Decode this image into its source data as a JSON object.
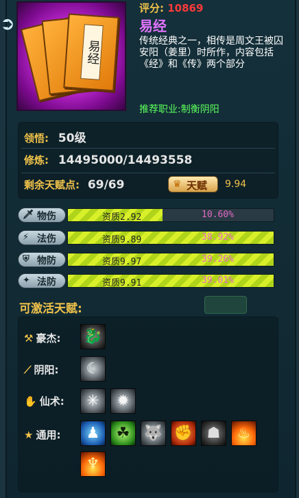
{
  "item": {
    "rating_label": "评分:",
    "rating_value": "10869",
    "name": "易经",
    "book_glyph": "易经",
    "description": "传统经典之一，相传是周文王被囚安阳（姜里）时所作，内容包括《经》和《传》两个部分",
    "recommend": "推荐职业:制衡阴阳"
  },
  "stats": {
    "comprehension_label": "领悟:",
    "comprehension_value": "50级",
    "training_label": "修炼:",
    "training_value": "14495000/14493558",
    "talent_points_label": "剩余天赋点:",
    "talent_points_value": "69/69",
    "talent_button_label": "天赋",
    "talent_bonus": "9.94"
  },
  "aptitudes": [
    {
      "label": "物伤",
      "icon": "sword-icon",
      "glyph": "🗡",
      "quality": "资质2.92",
      "percent": "10.60%",
      "fill": 0.46
    },
    {
      "label": "法伤",
      "icon": "lightning-icon",
      "glyph": "⚡",
      "quality": "资质9.89",
      "percent": "38.92%",
      "fill": 1.0
    },
    {
      "label": "物防",
      "icon": "shield-icon",
      "glyph": "⛨",
      "quality": "资质9.97",
      "percent": "39.26%",
      "fill": 1.0
    },
    {
      "label": "法防",
      "icon": "magic-shield-icon",
      "glyph": "✦",
      "quality": "资质9.91",
      "percent": "39.01%",
      "fill": 1.0
    }
  ],
  "talents": {
    "title": "可激活天赋:",
    "categories": [
      {
        "label": "豪杰:",
        "icon": "axe-icon"
      },
      {
        "label": "阴阳:",
        "icon": "staff-icon"
      },
      {
        "label": "仙术:",
        "icon": "hand-icon"
      },
      {
        "label": "通用:",
        "icon": "star-icon"
      }
    ]
  },
  "colors": {
    "accent_gold": "#f0c24a",
    "item_name_purple": "#e274ff",
    "recommend_green": "#5cff5c",
    "rating_red": "#ff3a3a",
    "percent_pink": "#e46ac8",
    "bar_fill": "#d8f02a"
  }
}
